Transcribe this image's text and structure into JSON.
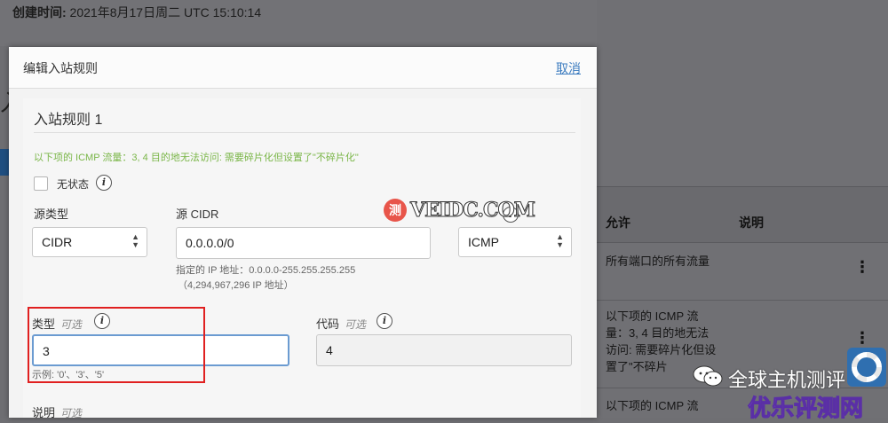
{
  "background": {
    "created_label": "创建时间:",
    "created_value": " 2021年8月17日周二 UTC 15:10:14",
    "left_mark": "入",
    "table_headers": {
      "allow": "允许",
      "description": "说明"
    },
    "rows": [
      {
        "allow": "所有端口的所有流量"
      },
      {
        "allow": "以下项的 ICMP 流量：3, 4 目的地无法访问: 需要碎片化但设置了\"不碎片"
      },
      {
        "allow": "以下项的 ICMP 流"
      }
    ]
  },
  "modal": {
    "title": "编辑入站规则",
    "cancel": "取消",
    "rule_title": "入站规则 1",
    "warning": "以下项的 ICMP 流量：3, 4 目的地无法访问: 需要碎片化但设置了\"不碎片化\"",
    "stateless_label": "无状态",
    "source_type_label": "源类型",
    "source_type_value": "CIDR",
    "source_cidr_label": "源 CIDR",
    "source_cidr_value": "0.0.0.0/0",
    "cidr_hint_1": "指定的 IP 地址：0.0.0.0-255.255.255.255",
    "cidr_hint_2": "（4,294,967,296 IP 地址）",
    "protocol_value": "ICMP",
    "type_label": "类型",
    "type_optional": "可选",
    "type_value": "3",
    "type_example": "示例: '0'、'3'、'5'",
    "code_label": "代码",
    "code_optional": "可选",
    "code_value": "4",
    "desc_label": "说明",
    "desc_optional": "可选"
  },
  "overlays": {
    "watermark_circle": "测",
    "watermark_text": "VEIDC.COM",
    "wechat_text": "全球主机测评",
    "brand_text": "优乐评测网"
  },
  "colors": {
    "warning": "#7ab648",
    "link": "#3b7bbf",
    "highlight": "#e02020"
  }
}
